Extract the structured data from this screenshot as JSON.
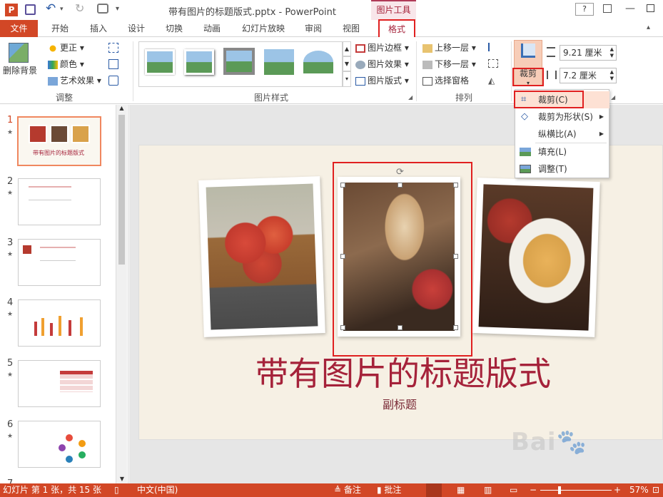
{
  "titlebar": {
    "title": "带有图片的标题版式.pptx - PowerPoint",
    "tools_label": "图片工具",
    "help": "?"
  },
  "tabs": [
    {
      "label": "文件"
    },
    {
      "label": "开始"
    },
    {
      "label": "插入"
    },
    {
      "label": "设计"
    },
    {
      "label": "切换"
    },
    {
      "label": "动画"
    },
    {
      "label": "幻灯片放映"
    },
    {
      "label": "审阅"
    },
    {
      "label": "视图"
    },
    {
      "label": "格式"
    }
  ],
  "ribbon": {
    "remove_bg": "删除背景",
    "adjust": {
      "correct": "更正",
      "color": "颜色",
      "art": "艺术效果",
      "label": "调整"
    },
    "styles_label": "图片样式",
    "border": "图片边框",
    "effect": "图片效果",
    "layout": "图片版式",
    "arrange": {
      "up": "上移一层",
      "down": "下移一层",
      "pane": "选择窗格",
      "label": "排列"
    },
    "crop": "裁剪",
    "height": "9.21 厘米",
    "width": "7.2 厘米"
  },
  "crop_menu": [
    {
      "label": "裁剪(C)"
    },
    {
      "label": "裁剪为形状(S)"
    },
    {
      "label": "纵横比(A)"
    },
    {
      "label": "填充(L)"
    },
    {
      "label": "调整(T)"
    }
  ],
  "slides": [
    {
      "num": "1"
    },
    {
      "num": "2"
    },
    {
      "num": "3"
    },
    {
      "num": "4"
    },
    {
      "num": "5"
    },
    {
      "num": "6"
    },
    {
      "num": "7"
    }
  ],
  "slide": {
    "title": "带有图片的标题版式",
    "subtitle": "副标题",
    "thumb_title": "带有图片的标题版式"
  },
  "status": {
    "info": "幻灯片 第 1 张，共 15 张",
    "lang": "中文(中国)",
    "notes": "备注",
    "comments": "批注",
    "zoom": "57%"
  },
  "colors": {
    "accent": "#d24726",
    "slide_title": "#a5223a",
    "highlight": "#e02020"
  }
}
